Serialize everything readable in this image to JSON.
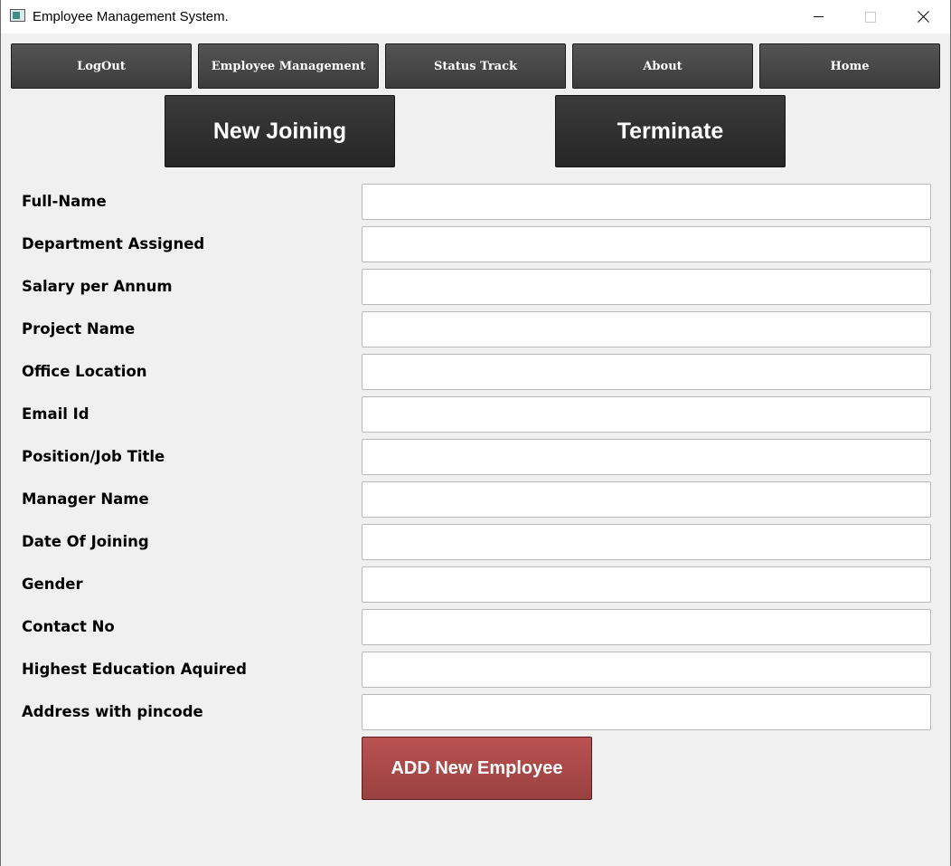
{
  "window": {
    "title": "Employee Management System."
  },
  "nav": [
    {
      "label": "LogOut"
    },
    {
      "label": "Employee Management"
    },
    {
      "label": "Status Track"
    },
    {
      "label": "About"
    },
    {
      "label": "Home"
    }
  ],
  "actions": {
    "new_joining": "New Joining",
    "terminate": "Terminate"
  },
  "form": {
    "fields": [
      {
        "label": "Full-Name",
        "value": ""
      },
      {
        "label": "Department Assigned",
        "value": ""
      },
      {
        "label": "Salary per Annum",
        "value": ""
      },
      {
        "label": "Project Name",
        "value": ""
      },
      {
        "label": "Office Location",
        "value": ""
      },
      {
        "label": "Email Id",
        "value": ""
      },
      {
        "label": "Position/Job Title",
        "value": ""
      },
      {
        "label": "Manager Name",
        "value": ""
      },
      {
        "label": "Date Of Joining",
        "value": ""
      },
      {
        "label": "Gender",
        "value": ""
      },
      {
        "label": "Contact No",
        "value": ""
      },
      {
        "label": "Highest Education Aquired",
        "value": ""
      },
      {
        "label": "Address with pincode",
        "value": ""
      }
    ],
    "submit_label": "ADD New Employee"
  },
  "icons": {
    "app": "app-window-icon",
    "minimize": "minimize-icon",
    "maximize": "maximize-icon",
    "close": "close-icon"
  },
  "colors": {
    "nav_button": "#454545",
    "action_button": "#2e2e2e",
    "submit_button": "#a94848",
    "background": "#f0f0f0"
  }
}
